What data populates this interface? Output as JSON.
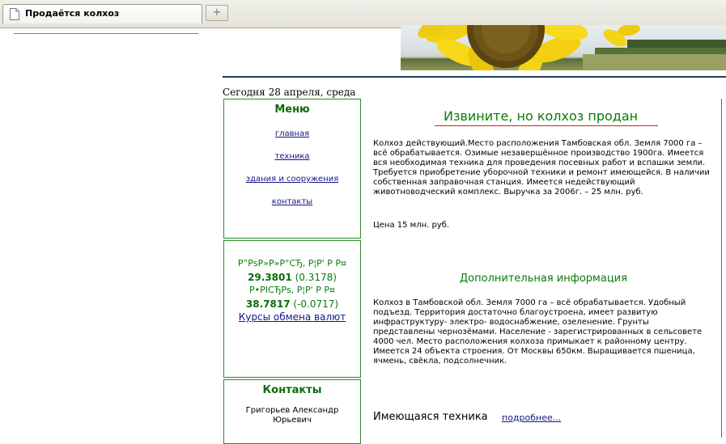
{
  "browser": {
    "tab_title": "Продаётся колхоз",
    "new_tab_glyph": "+"
  },
  "page": {
    "date": "Сегодня 28 апреля, среда",
    "menu": {
      "title": "Меню",
      "items": [
        "главная",
        "техника",
        "здания и сооружения",
        "контакты"
      ]
    },
    "rates": {
      "usd_label": "Р”РѕР»Р»Р°СЂ, Р¦Р' Р Р¤",
      "usd_value": "29.3801",
      "usd_change": "(0.3178)",
      "eur_label": "Р•РІСЂРѕ, Р¦Р' Р Р¤",
      "eur_value": "38.7817",
      "eur_change": "(-0.0717)",
      "link": "Курсы обмена валют"
    },
    "contacts": {
      "title": "Контакты",
      "name": "Григорьев Александр Юрьевич"
    },
    "headline": "Извините, но колхоз продан",
    "description": "Колхоз действующий.Место расположения Тамбовская обл. Земля 7000 га – всё обрабатывается. Озимые незавершённое производство 1900га. Имеется вся необходимая техника для проведения посевных работ и вспашки земли. Требуется приобретение уборочной техники и ремонт имеющейся. В наличии собственная заправочная станция. Имеется недействующий животноводческий комплекс. Выручка за 2006г. – 25 млн. руб.",
    "price": "Цена 15 млн. руб.",
    "subheading": "Дополнительная информация",
    "additional": "Колхоз в Тамбовской обл. Земля 7000 га – всё обрабатывается. Удобный подъезд. Территория достаточно благоустроена, имеет развитую инфраструктуру- электро- водоснабжение, озеленение. Грунты представлены чернозёмами. Население - зарегистрированных в сельсовете 4000 чел. Место расположения колхоза примыкает к районному центру. Имеется 24 объекта строения. От Москвы 650км. Выращивается пшеница, ячмень, свёкла, подсолнечник.",
    "equipment_label": "Имеющаяся техника",
    "more_link": "подробнее..."
  },
  "colors": {
    "green": "#0b7a0b",
    "link": "#15158c",
    "accent_red": "#cc2222",
    "header_rule": "#1d3d58"
  }
}
